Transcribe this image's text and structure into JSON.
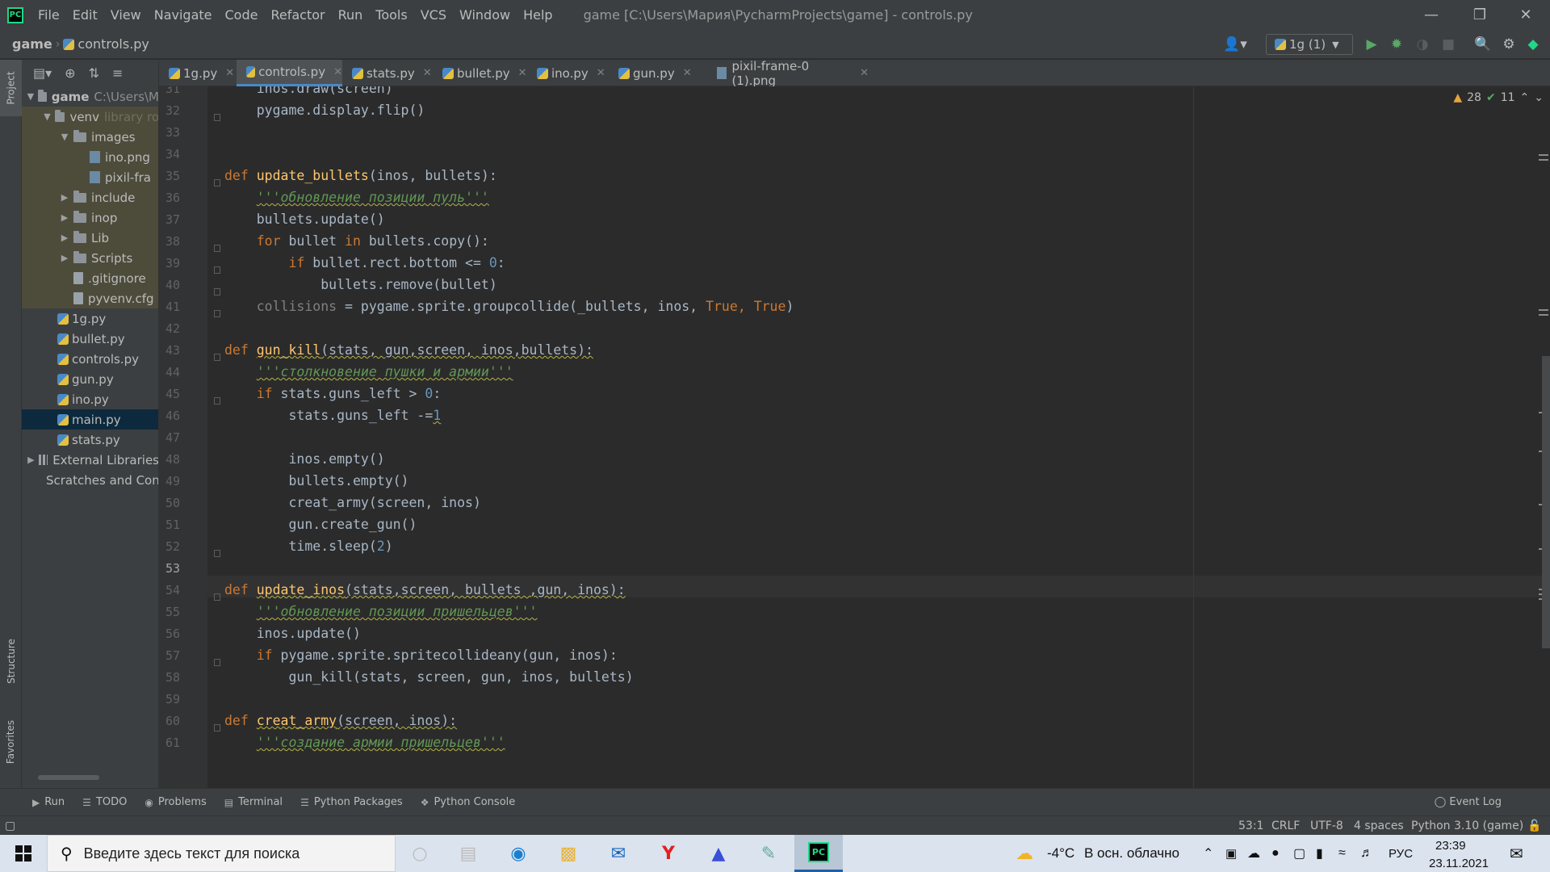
{
  "menu": [
    "File",
    "Edit",
    "View",
    "Navigate",
    "Code",
    "Refactor",
    "Run",
    "Tools",
    "VCS",
    "Window",
    "Help"
  ],
  "window_title": "game [C:\\Users\\Мария\\PycharmProjects\\game] - controls.py",
  "breadcrumb": {
    "project": "game",
    "file": "controls.py"
  },
  "run_config": "1g (1)",
  "tabs": [
    {
      "label": "1g.py"
    },
    {
      "label": "controls.py"
    },
    {
      "label": "stats.py"
    },
    {
      "label": "bullet.py"
    },
    {
      "label": "ino.py"
    },
    {
      "label": "gun.py"
    },
    {
      "label": "pixil-frame-0 (1).png"
    }
  ],
  "side_tabs": {
    "project": "Project",
    "structure": "Structure",
    "favorites": "Favorites"
  },
  "tree": [
    {
      "label": "game",
      "extra": "C:\\Users\\M"
    },
    {
      "label": "venv",
      "extra": "library ro"
    },
    {
      "label": "images"
    },
    {
      "label": "ino.png"
    },
    {
      "label": "pixil-fra"
    },
    {
      "label": "include"
    },
    {
      "label": "inop"
    },
    {
      "label": "Lib"
    },
    {
      "label": "Scripts"
    },
    {
      "label": ".gitignore"
    },
    {
      "label": "pyvenv.cfg"
    },
    {
      "label": "1g.py"
    },
    {
      "label": "bullet.py"
    },
    {
      "label": "controls.py"
    },
    {
      "label": "gun.py"
    },
    {
      "label": "ino.py"
    },
    {
      "label": "main.py"
    },
    {
      "label": "stats.py"
    },
    {
      "label": "External Libraries"
    },
    {
      "label": "Scratches and Con"
    }
  ],
  "inspections": {
    "warnings": "28",
    "ok": "11"
  },
  "code": {
    "l31": "inos.draw(screen)",
    "l32": "pygame.display.flip()",
    "l35_def": "def",
    "l35_name": "update_bullets",
    "l35_rest": "(inos, bullets):",
    "l36": "'''обновление позиции пуль'''",
    "l37": "bullets.update()",
    "l38_kw1": "for",
    "l38_mid": " bullet ",
    "l38_kw2": "in",
    "l38_rest": " bullets.copy():",
    "l39_kw": "if",
    "l39_rest": " bullet.rect.bottom <= ",
    "l39_num": "0",
    "l39_end": ":",
    "l40": "bullets.remove(bullet)",
    "l41_var": "collisions",
    "l41_mid": " = pygame.sprite.groupcollide(_bullets, inos, ",
    "l41_t1": "True",
    "l41_sep": ", ",
    "l41_t2": "True",
    "l41_end": ")",
    "l43_def": "def",
    "l43_name": "gun_kill",
    "l43_rest": "(stats, gun,screen, inos,bullets):",
    "l44": "'''столкновение пушки и армии'''",
    "l45_kw": "if",
    "l45_rest": " stats.guns_left > ",
    "l45_num": "0",
    "l45_end": ":",
    "l46": "stats.guns_left -=",
    "l46_num": "1",
    "l48": "inos.empty()",
    "l49": "bullets.empty()",
    "l50": "creat_army(screen, inos)",
    "l51": "gun.create_gun()",
    "l52": "time.sleep(",
    "l52_num": "2",
    "l52_end": ")",
    "l54_def": "def",
    "l54_name": "update_inos",
    "l54_rest": "(stats,screen, bullets ,gun, inos):",
    "l55": "'''обновление позиции пришельцев'''",
    "l56": "inos.update()",
    "l57_kw": "if",
    "l57_rest": " pygame.sprite.spritecollideany(gun, inos):",
    "l58": "gun_kill(stats, screen, gun, inos, bullets)",
    "l60_def": "def",
    "l60_name": "creat_army",
    "l60_rest": "(screen, inos):",
    "l61": "'''создание армии пришельцев'''"
  },
  "line_numbers": [
    "31",
    "32",
    "33",
    "34",
    "35",
    "36",
    "37",
    "38",
    "39",
    "40",
    "41",
    "42",
    "43",
    "44",
    "45",
    "46",
    "47",
    "48",
    "49",
    "50",
    "51",
    "52",
    "53",
    "54",
    "55",
    "56",
    "57",
    "58",
    "59",
    "60",
    "61"
  ],
  "tool_windows": [
    "Run",
    "TODO",
    "Problems",
    "Terminal",
    "Python Packages",
    "Python Console"
  ],
  "event_log": "Event Log",
  "status": {
    "position": "53:1",
    "line_sep": "CRLF",
    "encoding": "UTF-8",
    "indent": "4 spaces",
    "interpreter": "Python 3.10 (game)"
  },
  "taskbar": {
    "search_placeholder": "Введите здесь текст для поиска",
    "weather_temp": "-4°C",
    "weather_text": "В осн. облачно",
    "lang": "РУС",
    "time": "23:39",
    "date": "23.11.2021"
  },
  "colors": {
    "accent": "#4a88c7",
    "keyword": "#cc7832",
    "function": "#ffc66d",
    "docstring": "#629755",
    "number": "#6897bb"
  }
}
